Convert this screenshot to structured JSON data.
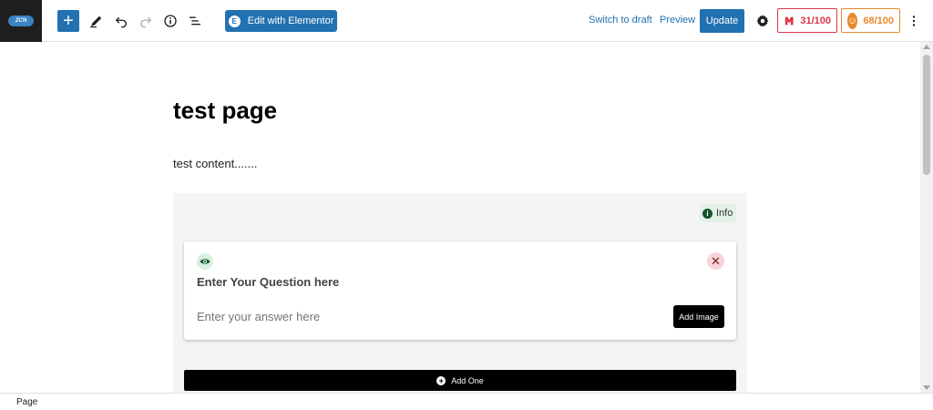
{
  "toolbar": {
    "site_logo_text": "ZCN",
    "edit_elementor_label": "Edit with Elementor",
    "switch_draft_label": "Switch to draft",
    "preview_label": "Preview",
    "update_label": "Update",
    "seo_score": "31/100",
    "readability_score": "68/100",
    "brand_color": "#2271b1",
    "seo_color": "#dc3545",
    "readability_color": "#e8892d"
  },
  "editor": {
    "title": "test page",
    "paragraph": "test content......."
  },
  "faq_block": {
    "info_label": "Info",
    "question_placeholder": "Enter Your Question here",
    "answer_placeholder": "Enter your answer here",
    "add_image_label": "Add Image",
    "add_one_label": "Add One"
  },
  "footer": {
    "breadcrumb": "Page"
  },
  "icons": {
    "site": "site-logo",
    "add": "plus-icon",
    "tools": "pencil-icon",
    "undo": "undo-icon",
    "redo": "redo-icon",
    "details": "info-icon",
    "outline": "list-view-icon",
    "settings": "gear-icon",
    "options": "more-vertical-icon"
  }
}
